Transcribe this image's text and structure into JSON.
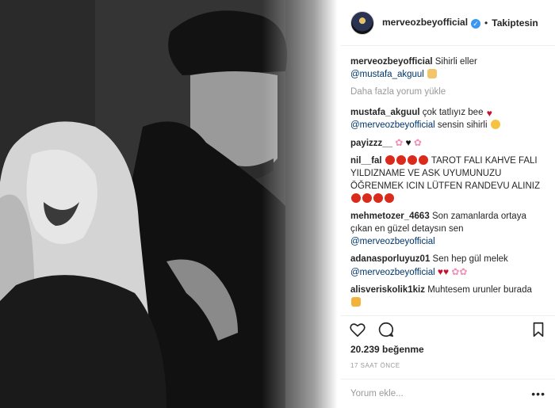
{
  "post": {
    "author": "merveozbeyofficial",
    "follow_label": "Takiptesin",
    "dot": "•",
    "caption_user": "merveozbeyofficial",
    "caption_text": "Sihirli eller",
    "caption_mention": "@mustafa_akguul",
    "load_more": "Daha fazla yorum yükle",
    "likes": "20.239 beğenme",
    "time": "17 SAAT ÖNCE",
    "add_comment_placeholder": "Yorum ekle...",
    "more_options": "•••"
  },
  "comments": [
    {
      "user": "mustafa_akguul",
      "text": "çok tatlıyız bee",
      "mention": "@merveozbeyofficial",
      "text2": "sensin sihirli"
    },
    {
      "user": "payizzz__",
      "text": ""
    },
    {
      "user": "nil__fal",
      "text": "TAROT FALI KAHVE FALI YILDIZNAME VE ASK UYUMUNUZU ÖĞRENMEK ICIN LÜTFEN RANDEVU ALINIZ"
    },
    {
      "user": "mehmetozer_4663",
      "text": "Son zamanlarda ortaya çıkan en güzel detaysın sen",
      "mention": "@merveozbeyofficial"
    },
    {
      "user": "adanasporluyuz01",
      "text": "Sen hep gül melek",
      "mention": "@merveozbeyofficial"
    },
    {
      "user": "alisveriskolik1kiz",
      "text": "Muhtesem urunler burada"
    }
  ],
  "colors": {
    "verified": "#3897f0",
    "mention": "#003569",
    "muted": "#999999"
  },
  "icons": [
    "heart-icon",
    "comment-icon",
    "bookmark-icon",
    "verified-icon"
  ]
}
